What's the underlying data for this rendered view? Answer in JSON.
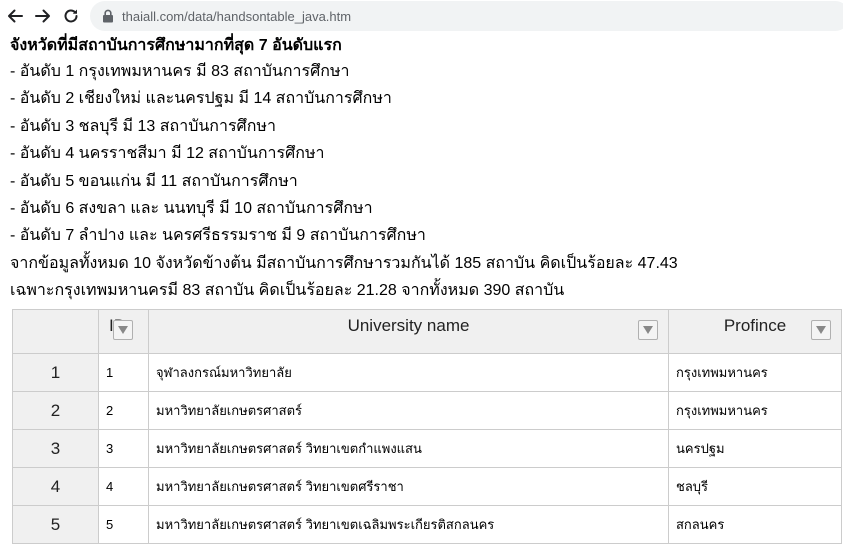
{
  "browser": {
    "url": "thaiall.com/data/handsontable_java.htm"
  },
  "content": {
    "heading": "จังหวัดที่มีสถาบันการศึกษามากที่สุด 7 อันดับแรก",
    "ranks": [
      "- อันดับ 1 กรุงเทพมหานคร มี 83 สถาบันการศึกษา",
      "- อันดับ 2 เชียงใหม่ และนครปฐม มี 14 สถาบันการศึกษา",
      "- อันดับ 3 ชลบุรี มี 13 สถาบันการศึกษา",
      "- อันดับ 4 นครราชสีมา มี 12 สถาบันการศึกษา",
      "- อันดับ 5 ขอนแก่น มี 11 สถาบันการศึกษา",
      "- อันดับ 6 สงขลา และ นนทบุรี มี 10 สถาบันการศึกษา",
      "- อันดับ 7 ลำปาง และ นครศรีธรรมราช มี 9 สถาบันการศึกษา"
    ],
    "summary_1": "จากข้อมูลทั้งหมด 10 จังหวัดข้างต้น มีสถาบันการศึกษารวมกันได้ 185 สถาบัน คิดเป็นร้อยละ 47.43",
    "summary_2": "เฉพาะกรุงเทพมหานครมี 83 สถาบัน คิดเป็นร้อยละ 21.28 จากทั้งหมด 390 สถาบัน"
  },
  "grid": {
    "headers": {
      "id": "ID",
      "university": "University name",
      "province": "Profince"
    },
    "rows": [
      {
        "row": "1",
        "id": "1",
        "university": "จุฬาลงกรณ์มหาวิทยาลัย",
        "province": "กรุงเทพมหานคร"
      },
      {
        "row": "2",
        "id": "2",
        "university": "มหาวิทยาลัยเกษตรศาสตร์",
        "province": "กรุงเทพมหานคร"
      },
      {
        "row": "3",
        "id": "3",
        "university": "มหาวิทยาลัยเกษตรศาสตร์ วิทยาเขตกำแพงแสน",
        "province": "นครปฐม"
      },
      {
        "row": "4",
        "id": "4",
        "university": "มหาวิทยาลัยเกษตรศาสตร์ วิทยาเขตศรีราชา",
        "province": "ชลบุรี"
      },
      {
        "row": "5",
        "id": "5",
        "university": "มหาวิทยาลัยเกษตรศาสตร์ วิทยาเขตเฉลิมพระเกียรติสกลนคร",
        "province": "สกลนคร"
      }
    ]
  },
  "icons": {
    "back": "arrow-left-icon",
    "forward": "arrow-right-icon",
    "reload": "reload-icon",
    "lock": "lock-icon",
    "filter": "triangle-down-icon"
  }
}
